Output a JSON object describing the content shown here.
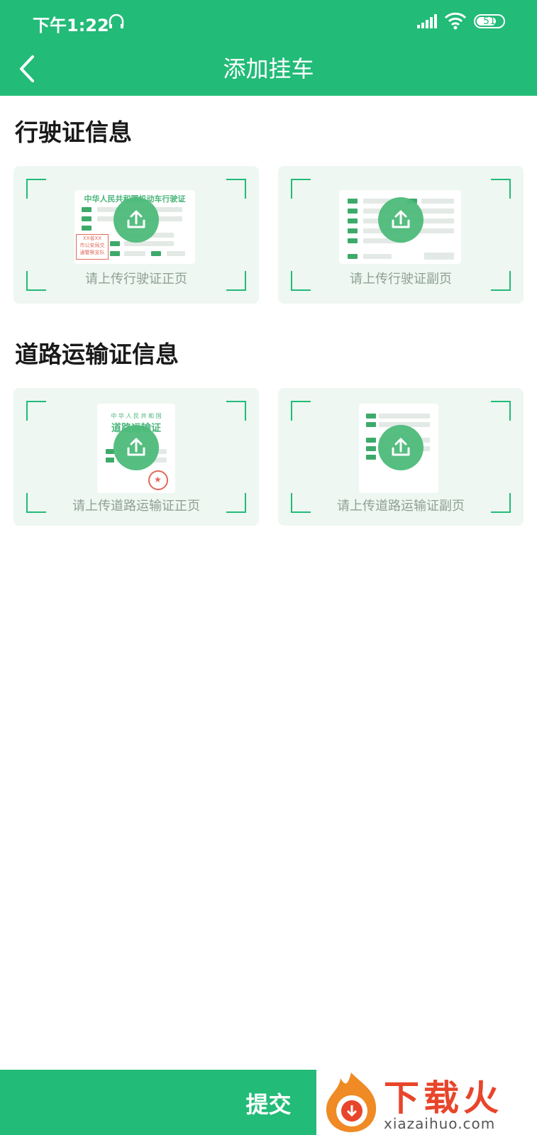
{
  "status_bar": {
    "time": "下午1:22",
    "battery": "51"
  },
  "header": {
    "title": "添加挂车"
  },
  "sections": [
    {
      "title": "行驶证信息",
      "cards": [
        {
          "caption": "请上传行驶证正页",
          "doc_title": "中华人民共和国机动车行驶证",
          "stamp": [
            "XX省XX",
            "市公安局交",
            "通警察支队"
          ]
        },
        {
          "caption": "请上传行驶证副页"
        }
      ]
    },
    {
      "title": "道路运输证信息",
      "cards": [
        {
          "caption": "请上传道路运输证正页",
          "doc_subtitle": "中 华 人 民 共 和 国",
          "doc_title": "道路运输证"
        },
        {
          "caption": "请上传道路运输证副页"
        }
      ]
    }
  ],
  "submit": {
    "label": "提交"
  },
  "watermark": {
    "brand": "下载火",
    "url": "xiazaihuo.com"
  },
  "colors": {
    "brand": "#22bb78",
    "card_bg": "#eef7f1"
  }
}
